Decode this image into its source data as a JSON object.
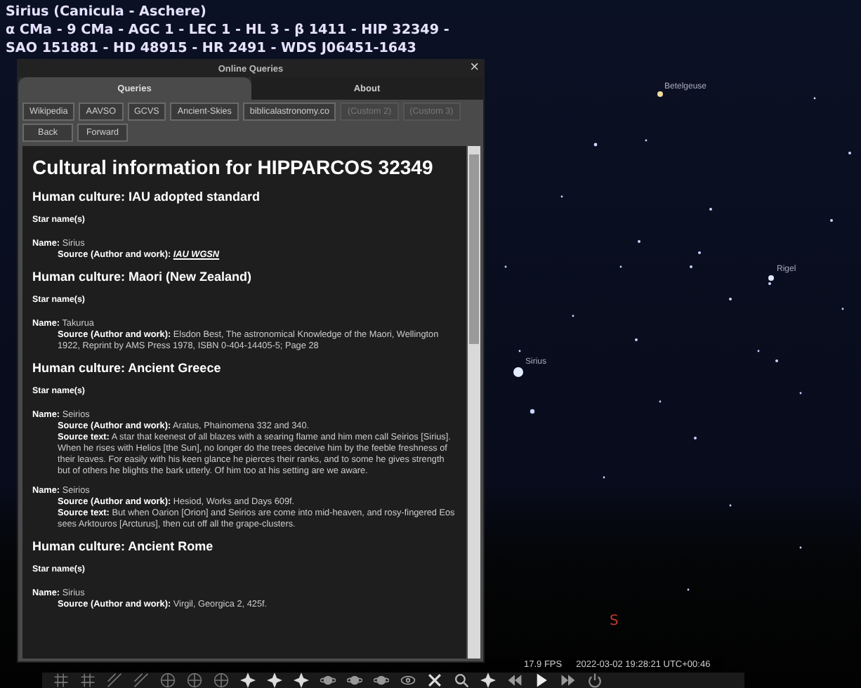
{
  "object_info": [
    "Sirius (Canicula - Aschere)",
    "α CMa - 9 CMa - AGC 1 - LEC 1 - HL 3 - β 1411 - HIP 32349 -",
    "SAO 151881 - HD 48915 - HR 2491 - WDS J06451-1643"
  ],
  "dialog": {
    "title": "Online Queries",
    "close": "×",
    "tabs": [
      {
        "label": "Queries",
        "selected": true
      },
      {
        "label": "About",
        "selected": false
      }
    ],
    "buttons": [
      {
        "label": "Wikipedia",
        "disabled": false
      },
      {
        "label": "AAVSO",
        "disabled": false
      },
      {
        "label": "GCVS",
        "disabled": false
      },
      {
        "label": "Ancient-Skies",
        "disabled": false
      },
      {
        "label": "biblicalastronomy.co",
        "disabled": false
      },
      {
        "label": "(Custom 2)",
        "disabled": true
      },
      {
        "label": "(Custom 3)",
        "disabled": true
      }
    ],
    "nav_buttons": [
      "Back",
      "Forward"
    ],
    "content": [
      {
        "kind": "title",
        "text": "Cultural information for HIPPARCOS 32349"
      },
      {
        "kind": "culture",
        "text": "Human culture: IAU adopted standard"
      },
      {
        "kind": "subhead",
        "text": "Star name(s)"
      },
      {
        "kind": "entry",
        "label": "Name:",
        "name": "Sirius",
        "sources": [
          {
            "label": "Source (Author and work):",
            "link": "IAU WGSN"
          }
        ]
      },
      {
        "kind": "culture",
        "text": "Human culture: Maori (New Zealand)"
      },
      {
        "kind": "subhead",
        "text": "Star name(s)"
      },
      {
        "kind": "entry",
        "label": "Name:",
        "name": "Takurua",
        "sources": [
          {
            "label": "Source (Author and work):",
            "text": "Elsdon Best, The astronomical Knowledge of the Maori, Wellington 1922, Reprint by AMS Press 1978, ISBN 0-404-14405-5; Page 28"
          }
        ]
      },
      {
        "kind": "culture",
        "text": "Human culture: Ancient Greece"
      },
      {
        "kind": "subhead",
        "text": "Star name(s)"
      },
      {
        "kind": "entry",
        "label": "Name:",
        "name": "Seirios",
        "sources": [
          {
            "label": "Source (Author and work):",
            "text": "Aratus, Phainomena 332 and 340."
          },
          {
            "label": "Source text:",
            "text": "A star that keenest of all blazes with a searing flame and him men call Seirios [Sirius]. When he rises with Helios [the Sun], no longer do the trees deceive him by the feeble freshness of their leaves. For easily with his keen glance he pierces their ranks, and to some he gives strength but of others he blights the bark utterly. Of him too at his setting are we aware."
          }
        ]
      },
      {
        "kind": "entry",
        "label": "Name:",
        "name": "Seirios",
        "sources": [
          {
            "label": "Source (Author and work):",
            "text": "Hesiod, Works and Days 609f."
          },
          {
            "label": "Source text:",
            "text": "But when Oarion [Orion] and Seirios are come into mid-heaven, and rosy-fingered Eos sees Arktouros [Arcturus], then cut off all the grape-clusters."
          }
        ]
      },
      {
        "kind": "culture",
        "text": "Human culture: Ancient Rome"
      },
      {
        "kind": "subhead",
        "text": "Star name(s)"
      },
      {
        "kind": "entry",
        "label": "Name:",
        "name": "Sirius",
        "sources": [
          {
            "label": "Source (Author and work):",
            "text": "Virgil, Georgica 2, 425f."
          }
        ]
      }
    ]
  },
  "sky_labels": [
    "Betelgeuse",
    "Rigel",
    "Sirius"
  ],
  "compass_point": "S",
  "status_bar": {
    "fps": "17.9 FPS",
    "datetime": "2022-03-02 19:28:21 UTC+00:46"
  }
}
